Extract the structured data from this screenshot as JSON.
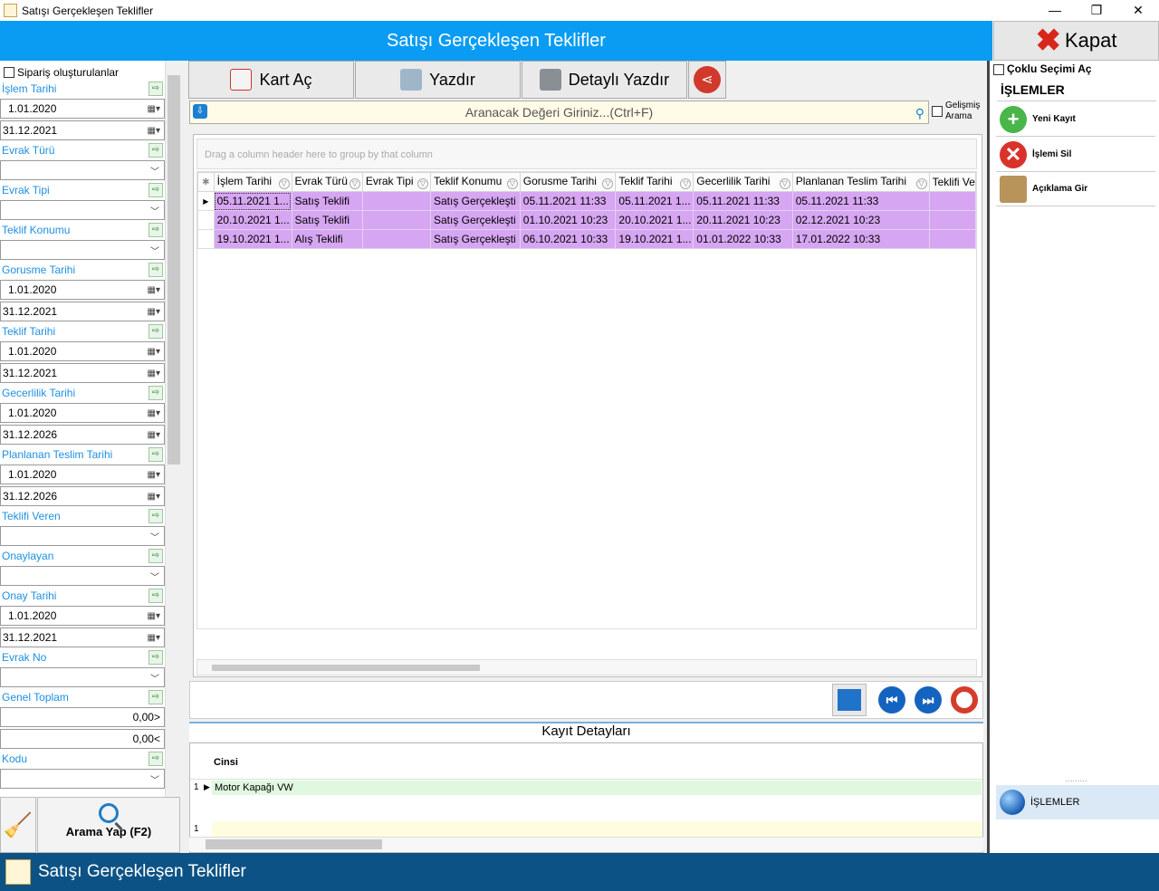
{
  "window": {
    "title": "Satışı Gerçekleşen Teklifler"
  },
  "header": {
    "title": "Satışı Gerçekleşen Teklifler",
    "close_label": "Kapat"
  },
  "left": {
    "order_created_label": "Sipariş oluşturulanlar",
    "fields": [
      {
        "label": "İşlem Tarihi",
        "from": "1.01.2020",
        "to": "31.12.2021"
      },
      {
        "label": "Evrak Türü"
      },
      {
        "label": "Evrak Tipi"
      },
      {
        "label": "Teklif Konumu"
      },
      {
        "label": "Gorusme Tarihi",
        "from": "1.01.2020",
        "to": "31.12.2021"
      },
      {
        "label": "Teklif Tarihi",
        "from": "1.01.2020",
        "to": "31.12.2021"
      },
      {
        "label": "Gecerlilik Tarihi",
        "from": "1.01.2020",
        "to": "31.12.2026"
      },
      {
        "label": "Planlanan Teslim Tarihi",
        "from": "1.01.2020",
        "to": "31.12.2026"
      },
      {
        "label": "Teklifi Veren"
      },
      {
        "label": "Onaylayan"
      },
      {
        "label": "Onay Tarihi",
        "from": "1.01.2020",
        "to": "31.12.2021"
      },
      {
        "label": "Evrak No"
      },
      {
        "label": "Genel Toplam",
        "from": "0,00>",
        "to": "0,00<"
      },
      {
        "label": "Kodu"
      }
    ],
    "search_button": "Arama Yap (F2)"
  },
  "toolbar": {
    "open_card": "Kart Aç",
    "print": "Yazdır",
    "detailed_print": "Detaylı Yazdır"
  },
  "search": {
    "placeholder": "Aranacak Değeri Giriniz...(Ctrl+F)",
    "advanced_line1": "Gelişmiş",
    "advanced_line2": "Arama"
  },
  "grid": {
    "group_hint": "Drag a column header here to group by that column",
    "columns": [
      "İşlem Tarihi",
      "Evrak Türü",
      "Evrak Tipi",
      "Teklif Konumu",
      "Gorusme Tarihi",
      "Teklif Tarihi",
      "Gecerlilik Tarihi",
      "Planlanan Teslim Tarihi",
      "Teklifi Ve"
    ],
    "rows": [
      [
        "05.11.2021 1...",
        "Satış Teklifi",
        "",
        "Satış Gerçekleşti",
        "05.11.2021 11:33",
        "05.11.2021 1...",
        "05.11.2021 11:33",
        "05.11.2021 11:33",
        ""
      ],
      [
        "20.10.2021 1...",
        "Satış Teklifi",
        "",
        "Satış Gerçekleşti",
        "01.10.2021 10:23",
        "20.10.2021 1...",
        "20.11.2021 10:23",
        "02.12.2021 10:23",
        ""
      ],
      [
        "19.10.2021 1...",
        "Alış Teklifi",
        "",
        "Satış Gerçekleşti",
        "06.10.2021 10:33",
        "19.10.2021 1...",
        "01.01.2022 10:33",
        "17.01.2022 10:33",
        ""
      ]
    ]
  },
  "details": {
    "title": "Kayıt Detayları",
    "column": "Cinsi",
    "rows": [
      {
        "index": "1",
        "value": "Motor Kapağı VW"
      }
    ],
    "new_row_index": "1"
  },
  "right": {
    "multi_select": "Çoklu Seçimi Aç",
    "ops_title": "İŞLEMLER",
    "ops": [
      "Yeni Kayıt",
      "İşlemi Sil",
      "Açıklama Gir"
    ],
    "ops_bar": "İŞLEMLER"
  },
  "footer": {
    "title": "Satışı Gerçekleşen Teklifler"
  }
}
